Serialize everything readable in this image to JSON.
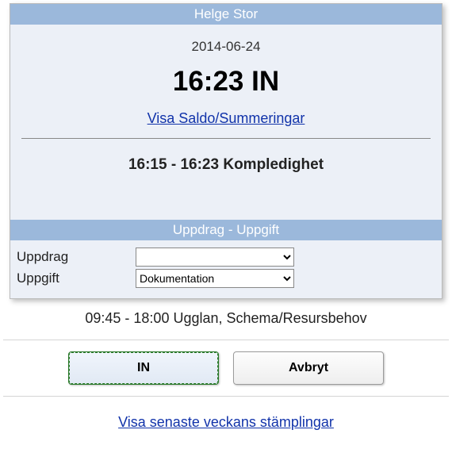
{
  "header": {
    "name": "Helge Stor"
  },
  "date": "2014-06-24",
  "clock": {
    "time": "16:23",
    "state": "IN"
  },
  "links": {
    "saldo": "Visa Saldo/Summeringar",
    "recent": "Visa senaste veckans stämplingar"
  },
  "current": {
    "from": "16:15",
    "to": "16:23",
    "label": "Kompledighet"
  },
  "section": {
    "title": "Uppdrag - Uppgift"
  },
  "form": {
    "uppdrag": {
      "label": "Uppdrag",
      "value": ""
    },
    "uppgift": {
      "label": "Uppgift",
      "value": "Dokumentation"
    }
  },
  "schedule": {
    "from": "09:45",
    "to": "18:00",
    "place": "Ugglan",
    "type": "Schema/Resursbehov"
  },
  "buttons": {
    "in": "IN",
    "cancel": "Avbryt"
  }
}
